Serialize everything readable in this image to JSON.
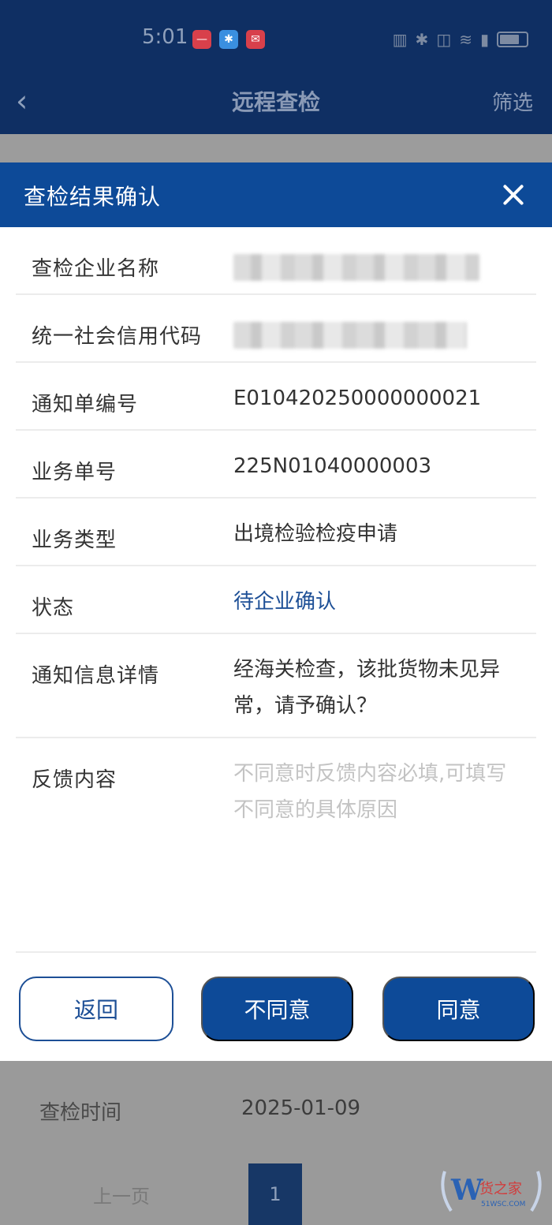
{
  "statusbar": {
    "time": "5:01",
    "icons": [
      "message-icon",
      "bluetooth-icon",
      "mail-icon"
    ]
  },
  "navbar": {
    "back_icon": "chevron-left-icon",
    "title": "远程查检",
    "filter_label": "筛选"
  },
  "modal": {
    "title": "查检结果确认",
    "close_icon": "close-icon",
    "fields": [
      {
        "label": "查检企业名称",
        "value": "",
        "redacted": true
      },
      {
        "label": "统一社会信用代码",
        "value": "",
        "redacted": true
      },
      {
        "label": "通知单编号",
        "value": "E010420250000000021"
      },
      {
        "label": "业务单号",
        "value": "225N01040000003"
      },
      {
        "label": "业务类型",
        "value": "出境检验检疫申请"
      },
      {
        "label": "状态",
        "value": "待企业确认"
      },
      {
        "label": "通知信息详情",
        "value": "经海关检查，该批货物未见异常，请予确认？"
      },
      {
        "label": "反馈内容",
        "placeholder": "不同意时反馈内容必填,可填写不同意的具体原因"
      }
    ],
    "buttons": {
      "back": "返回",
      "disagree": "不同意",
      "agree": "同意"
    }
  },
  "background": {
    "inspection_time_label": "查检时间",
    "inspection_time_value": "2025-01-09",
    "prev_page": "上一页",
    "current_page": "1"
  },
  "colors": {
    "header_blue": "#0d4a98",
    "status_blue": "#1d4f96",
    "navbar_bg": "#0f2f63"
  },
  "watermark": {
    "text": "货之家",
    "sub": "51WSC.COM"
  }
}
